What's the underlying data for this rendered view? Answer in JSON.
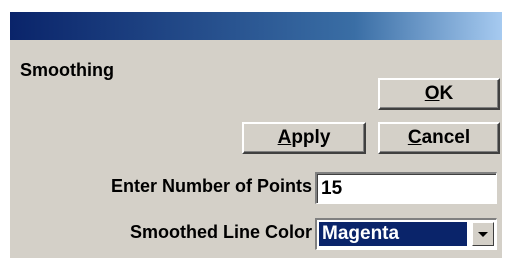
{
  "dialog": {
    "heading": "Smoothing",
    "buttons": {
      "ok": {
        "accel": "O",
        "rest": "K"
      },
      "apply": {
        "accel": "A",
        "rest": "pply"
      },
      "cancel": {
        "accel": "C",
        "rest": "ancel"
      }
    },
    "fields": {
      "points_label": "Enter Number of Points",
      "points_value": "15",
      "color_label": "Smoothed Line Color",
      "color_value": "Magenta"
    }
  },
  "icons": {
    "dropdown": "chevron-down-icon"
  },
  "colors": {
    "title_bar": "#0a246a",
    "dialog_bg": "#d4d0c8",
    "selection": "#0a246a"
  }
}
